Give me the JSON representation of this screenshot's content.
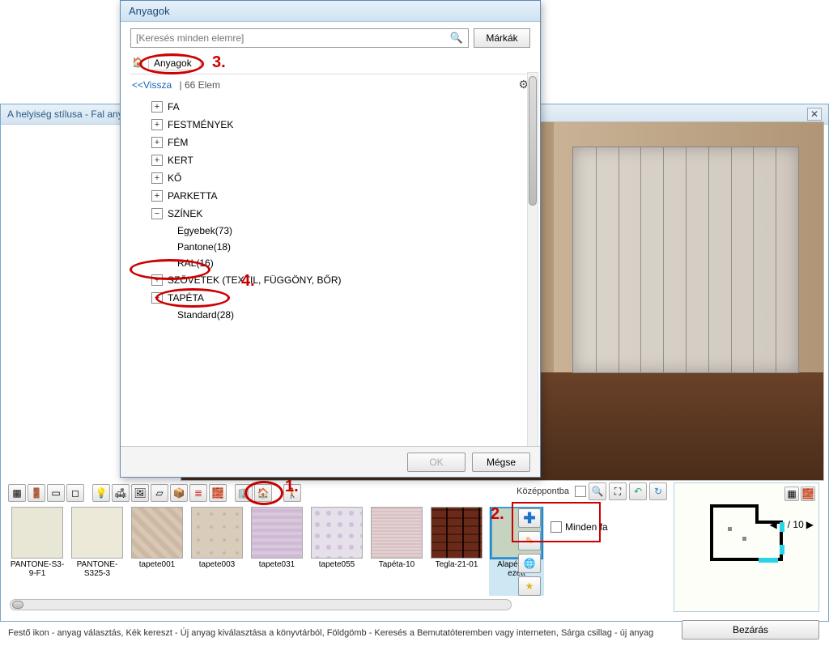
{
  "bgWindow": {
    "title": "A helyiség stílusa - Fal anya"
  },
  "dialog": {
    "title": "Anyagok",
    "searchPlaceholder": "[Keresés minden elemre]",
    "brands": "Márkák",
    "breadcrumb": "Anyagok",
    "back": "<<Vissza",
    "count": "| 66 Elem",
    "ok": "OK",
    "cancel": "Mégse",
    "tree": {
      "fa": "FA",
      "festmenyek": "FESTMÉNYEK",
      "fem": "FÉM",
      "kert": "KERT",
      "ko": "KŐ",
      "parketta": "PARKETTA",
      "szinek": "SZÍNEK",
      "egyebek": "Egyebek(73)",
      "pantone": "Pantone(18)",
      "ral": "RAL(16)",
      "szovetek": "SZÖVETEK (TEXTIL, FÜGGÖNY, BŐR)",
      "tapeta": "TAPÉTA",
      "standard": "Standard(28)"
    }
  },
  "toolbar": {
    "center": "Középpontba"
  },
  "swatches": [
    {
      "label": "PANTONE-S3-9-F1",
      "cls": "tx-cream"
    },
    {
      "label": "PANTONE-S325-3",
      "cls": "tx-cream2"
    },
    {
      "label": "tapete001",
      "cls": "tx-pat1"
    },
    {
      "label": "tapete003",
      "cls": "tx-pat2"
    },
    {
      "label": "tapete031",
      "cls": "tx-pat3"
    },
    {
      "label": "tapete055",
      "cls": "tx-pat4"
    },
    {
      "label": "Tapéta-10",
      "cls": "tx-pink"
    },
    {
      "label": "Tegla-21-01",
      "cls": "tx-brick"
    },
    {
      "label": "Alapértelm ezett",
      "cls": "tx-def",
      "sel": true
    }
  ],
  "mindFa": "Minden fa",
  "pager": "1 / 10",
  "status": "Festő ikon - anyag választás, Kék kereszt - Új anyag kiválasztása a könyvtárból, Földgömb - Keresés a Bemutatóteremben vagy interneten, Sárga csillag - új anyag",
  "closeBtn": "Bezárás",
  "anno": {
    "n1": "1.",
    "n2": "2.",
    "n3": "3.",
    "n4": "4."
  }
}
